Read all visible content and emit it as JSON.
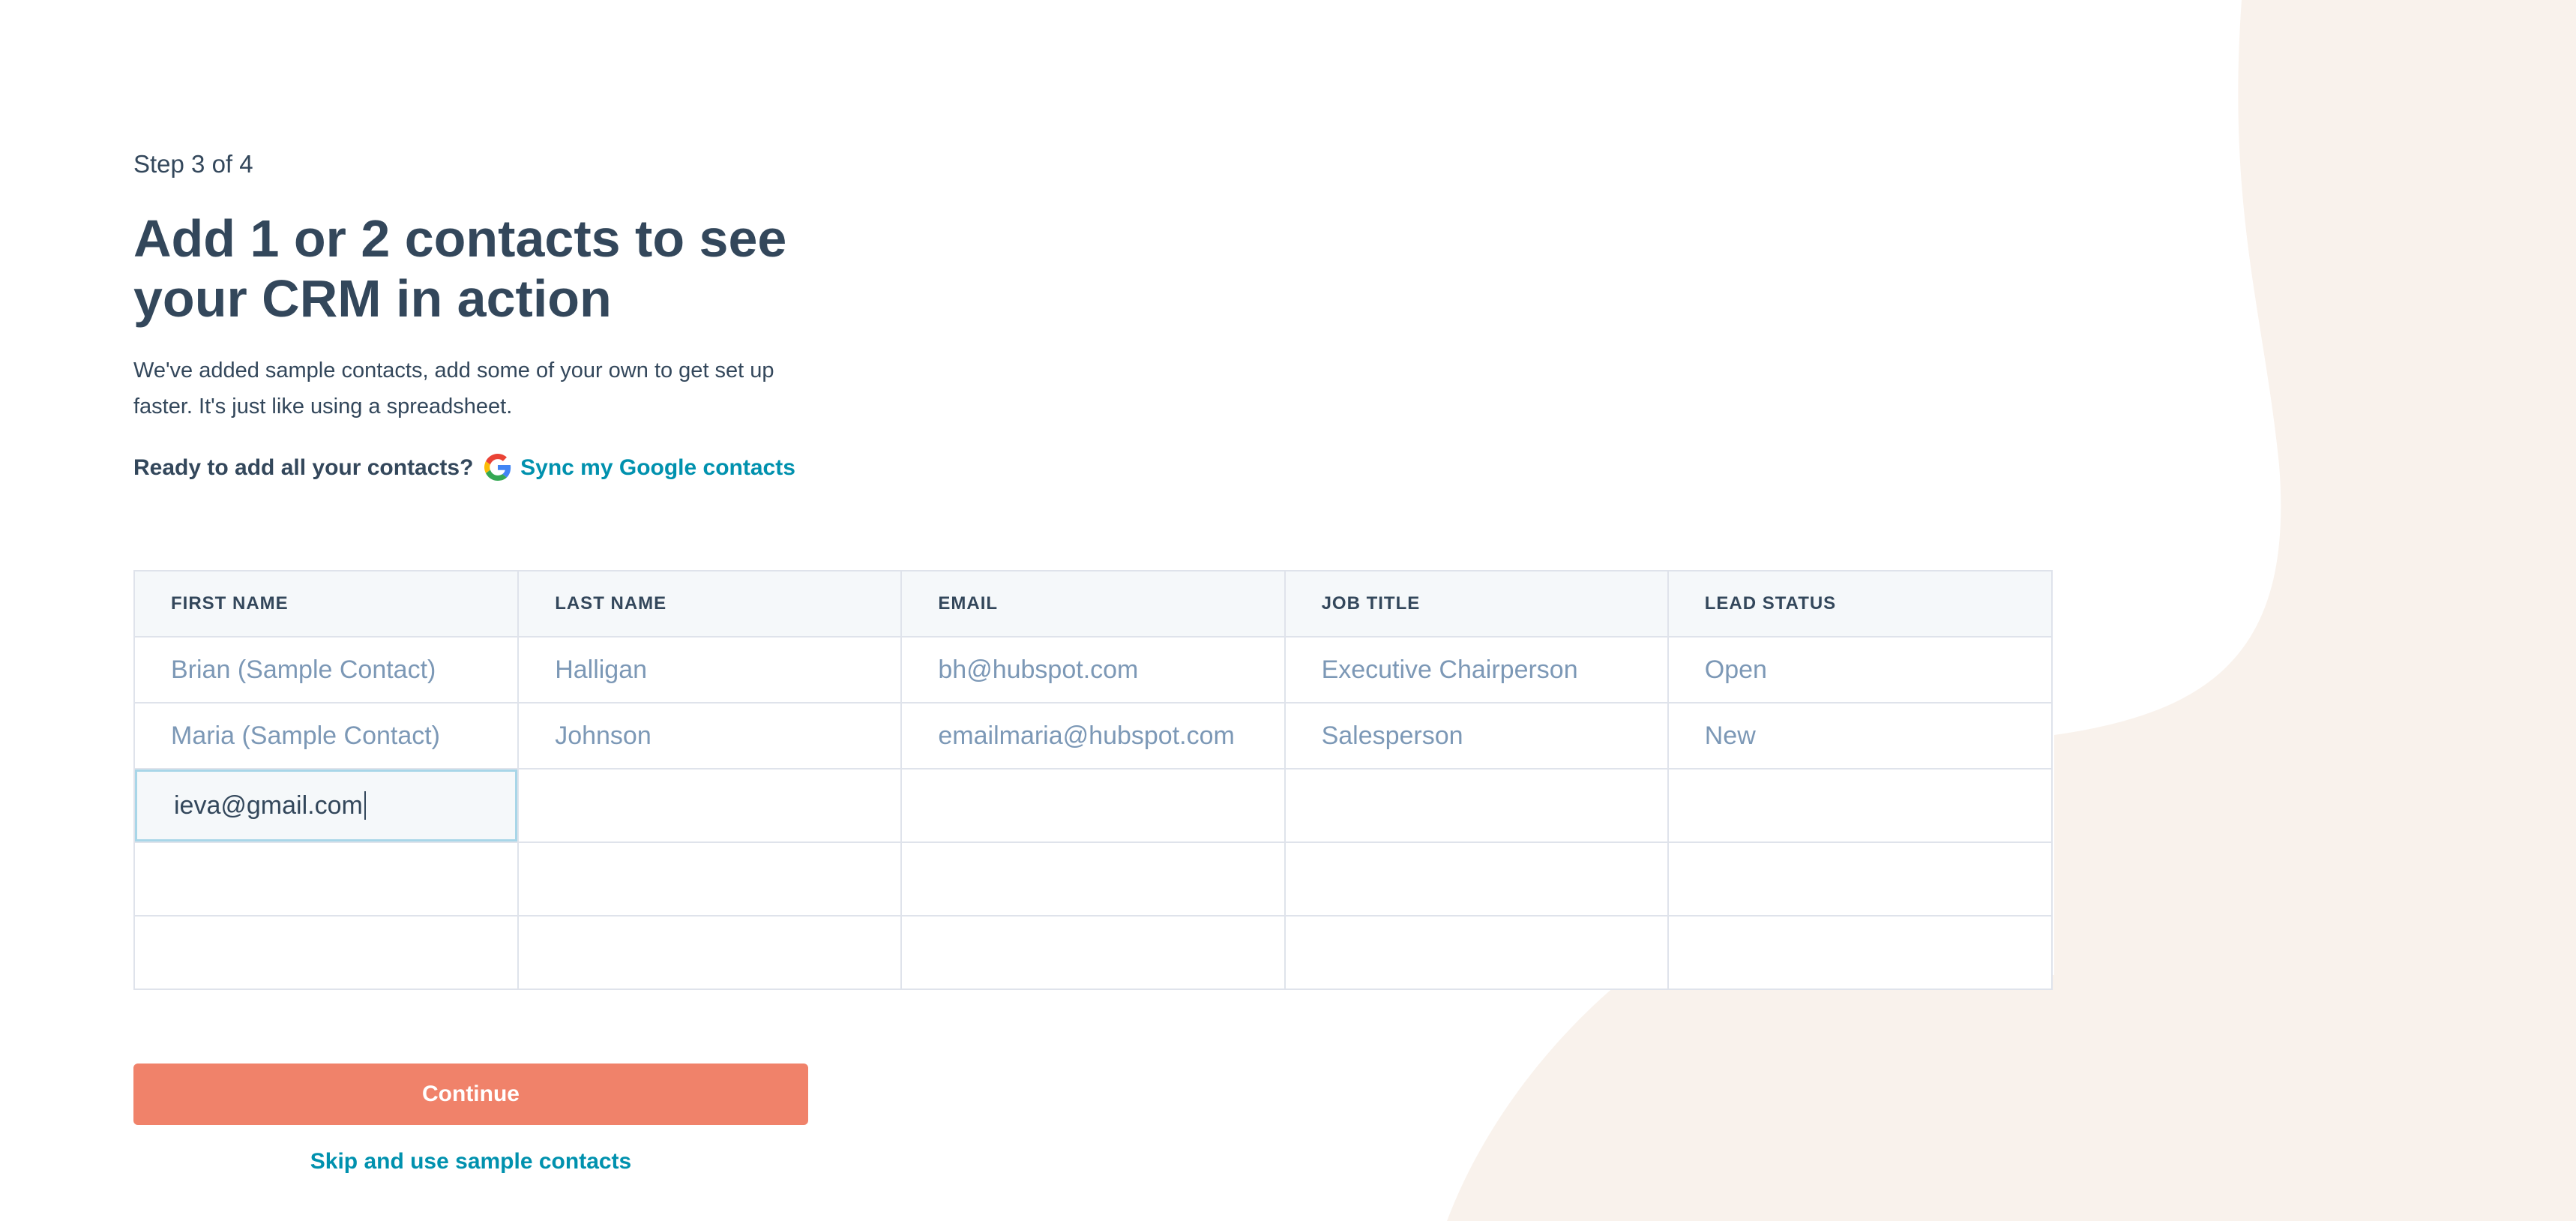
{
  "colors": {
    "text": "#33475b",
    "placeholder_text": "#7c98b6",
    "link": "#0091ae",
    "accent_button": "#f0826a",
    "background_shape": "#f9f2ec",
    "border": "#dfe3eb",
    "header_bg": "#f5f8fa",
    "active_cell_border": "#a8d6e8"
  },
  "step": "Step 3 of 4",
  "title": "Add 1 or 2 contacts to see your CRM in action",
  "description": "We've added sample contacts, add some of your own to get set up faster. It's just like using a spreadsheet.",
  "sync": {
    "prompt": "Ready to add all your contacts?",
    "icon": "google-icon",
    "link_label": "Sync my Google contacts"
  },
  "table": {
    "headers": [
      "FIRST NAME",
      "LAST NAME",
      "EMAIL",
      "JOB TITLE",
      "LEAD STATUS"
    ],
    "rows": [
      [
        "Brian (Sample Contact)",
        "Halligan",
        "bh@hubspot.com",
        "Executive Chairperson",
        "Open"
      ],
      [
        "Maria (Sample Contact)",
        "Johnson",
        "emailmaria@hubspot.com",
        "Salesperson",
        "New"
      ],
      [
        "ieva@gmail.com",
        "",
        "",
        "",
        ""
      ],
      [
        "",
        "",
        "",
        "",
        ""
      ],
      [
        "",
        "",
        "",
        "",
        ""
      ]
    ],
    "active_cell_value": "ieva@gmail.com"
  },
  "continue_label": "Continue",
  "skip_label": "Skip and use sample contacts"
}
